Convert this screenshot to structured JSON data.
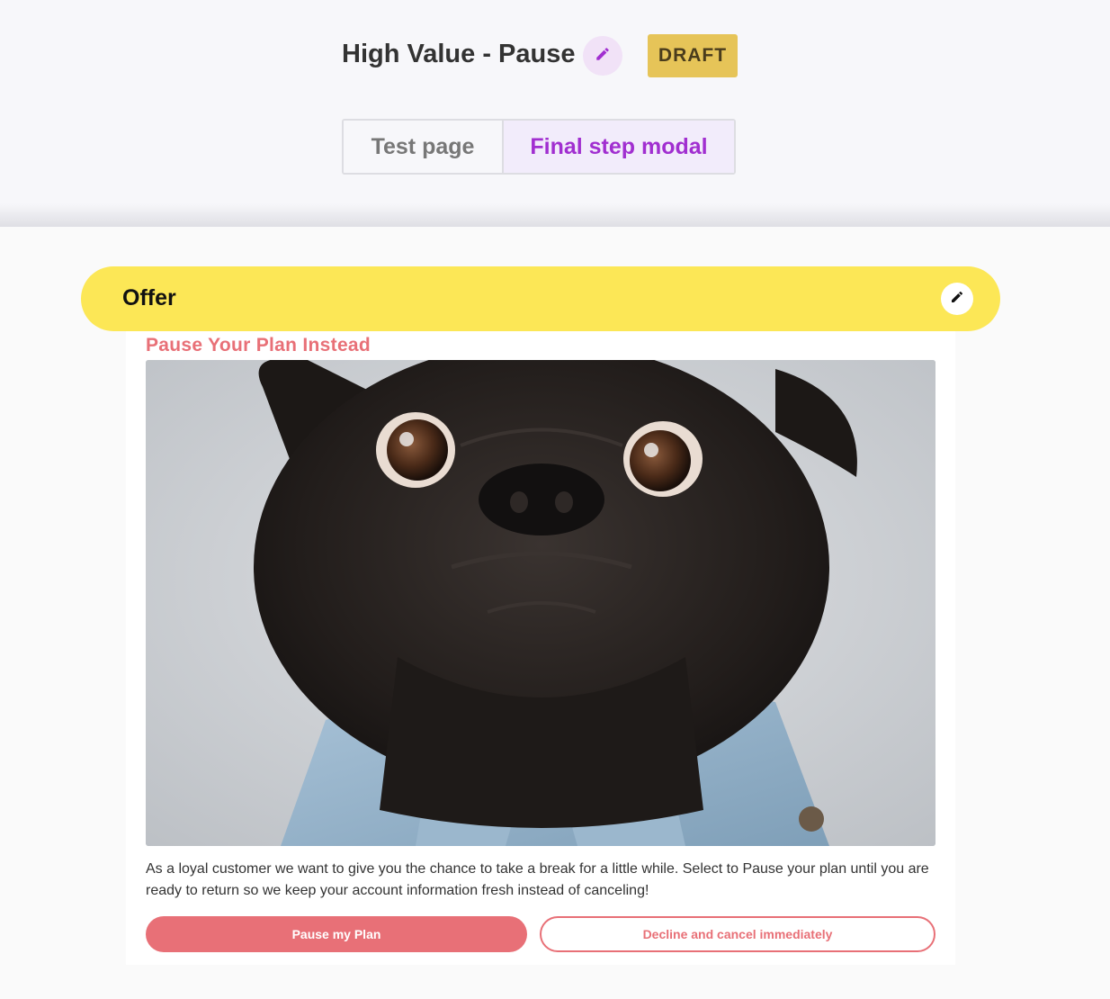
{
  "header": {
    "title": "High Value - Pause",
    "status_badge": "DRAFT",
    "edit_icon": "pencil-icon",
    "tabs": [
      {
        "label": "Test page",
        "active": false
      },
      {
        "label": "Final step modal",
        "active": true
      }
    ]
  },
  "offer": {
    "section_label": "Offer",
    "edit_icon": "pencil-icon",
    "heading": "Pause Your Plan Instead",
    "image": "pug-dog-in-denim-jacket-photo",
    "body": "As a loyal customer we want to give you the chance to take a break for a little while. Select to Pause your plan until you are ready to return so we keep your account information fresh instead of canceling!",
    "primary_button": "Pause my Plan",
    "secondary_button": "Decline and cancel immediately"
  },
  "colors": {
    "accent_purple": "#a12fd0",
    "draft_badge": "#e6c458",
    "offer_bar": "#fce756",
    "brand_coral": "#e87077"
  }
}
